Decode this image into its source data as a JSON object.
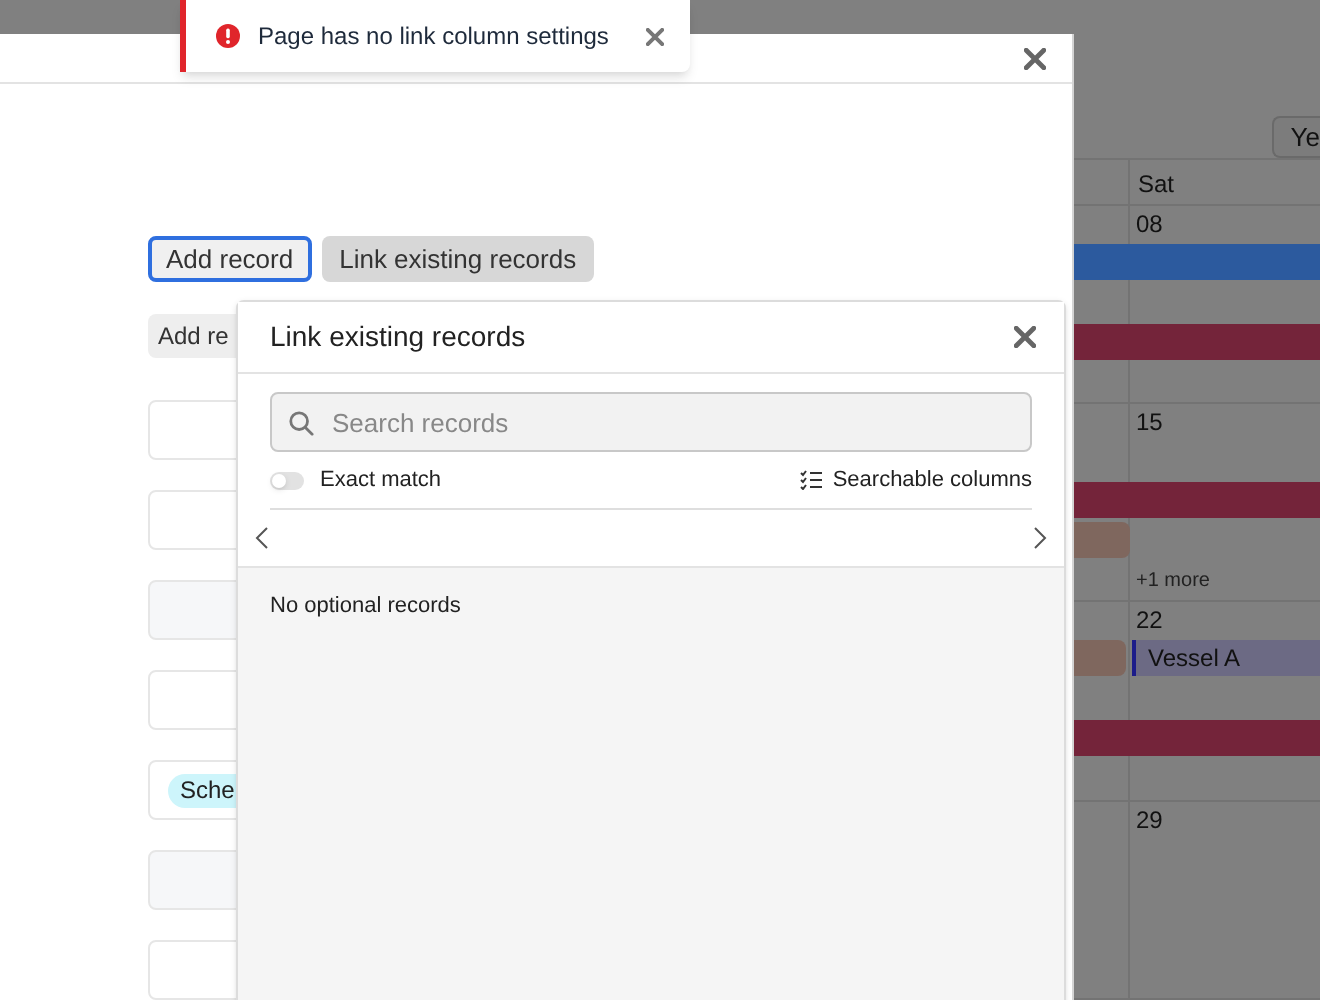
{
  "toast": {
    "message": "Page has no link column settings"
  },
  "calendar": {
    "view_button": "Ye",
    "day_header": "Sat",
    "weeks": [
      {
        "date": "08",
        "lanes": [
          {
            "kind": "bar",
            "color": "#2c5a9e"
          },
          {
            "kind": "gap"
          },
          {
            "kind": "bar",
            "color": "#74243a"
          }
        ]
      },
      {
        "date": "15",
        "lanes": [
          {
            "kind": "gap"
          },
          {
            "kind": "bar",
            "color": "#74243a"
          },
          {
            "kind": "left",
            "color": "#7f675e"
          }
        ],
        "more": "+1 more"
      },
      {
        "date": "22",
        "lanes": [
          {
            "kind": "split",
            "color": "#7f675e",
            "event": {
              "label": "Vessel A",
              "color": "#6c6a84"
            }
          },
          {
            "kind": "gap"
          },
          {
            "kind": "bar",
            "color": "#74243a"
          }
        ]
      },
      {
        "date": "29"
      }
    ]
  },
  "modal": {
    "buttons": [
      {
        "label": "Add record",
        "focused": true
      },
      {
        "label": "Link existing records",
        "focused": false
      }
    ],
    "second_button": "Add re",
    "fields": [
      {
        "kind": "plain"
      },
      {
        "kind": "plain"
      },
      {
        "kind": "shaded"
      },
      {
        "kind": "plain"
      },
      {
        "kind": "tag",
        "tag": "Sche"
      },
      {
        "kind": "shaded"
      },
      {
        "kind": "plain"
      }
    ]
  },
  "popover": {
    "title": "Link existing records",
    "search": {
      "placeholder": "Search records"
    },
    "exact_match": {
      "label": "Exact match",
      "on": false
    },
    "searchable_columns": "Searchable columns",
    "empty_message": "No optional records"
  }
}
